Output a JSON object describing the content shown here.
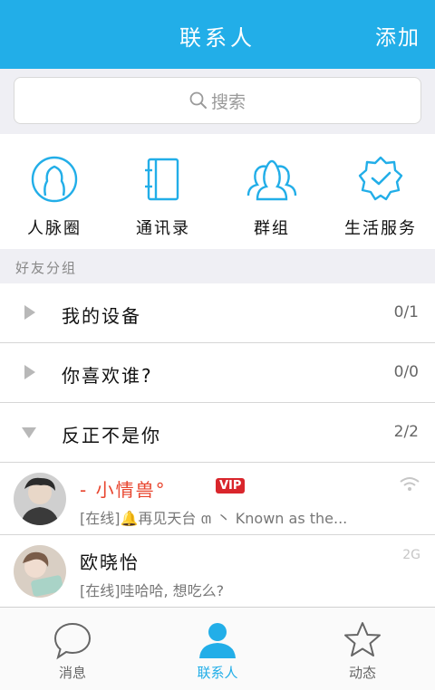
{
  "header": {
    "title": "联系人",
    "add_label": "添加"
  },
  "search": {
    "placeholder": "搜索"
  },
  "quick_actions": [
    {
      "label": "人脉圈",
      "icon": "person-circle-icon"
    },
    {
      "label": "通讯录",
      "icon": "address-book-icon"
    },
    {
      "label": "群组",
      "icon": "group-icon"
    },
    {
      "label": "生活服务",
      "icon": "verified-badge-icon"
    }
  ],
  "friend_groups_header": "好友分组",
  "groups": [
    {
      "name": "我的设备",
      "count": "0/1",
      "expanded": false
    },
    {
      "name": "你喜欢谁?",
      "count": "0/0",
      "expanded": false
    },
    {
      "name": "反正不是你",
      "count": "2/2",
      "expanded": true
    }
  ],
  "friends": [
    {
      "name": "-      小情兽°",
      "badge": "VIP",
      "status": "[在线]🔔再见天台 ຓ 丶 Known as the...",
      "right": "wifi-icon"
    },
    {
      "name": "欧晓怡",
      "badge": "",
      "status": "[在线]哇哈哈, 想吃么?",
      "right": "2G"
    }
  ],
  "tabs": [
    {
      "label": "消息",
      "icon": "chat-bubble-icon",
      "active": false
    },
    {
      "label": "联系人",
      "icon": "contact-person-icon",
      "active": true
    },
    {
      "label": "动态",
      "icon": "star-icon",
      "active": false
    }
  ],
  "colors": {
    "accent": "#22aee8",
    "name_red": "#e8442d",
    "vip_red": "#d9262c"
  }
}
